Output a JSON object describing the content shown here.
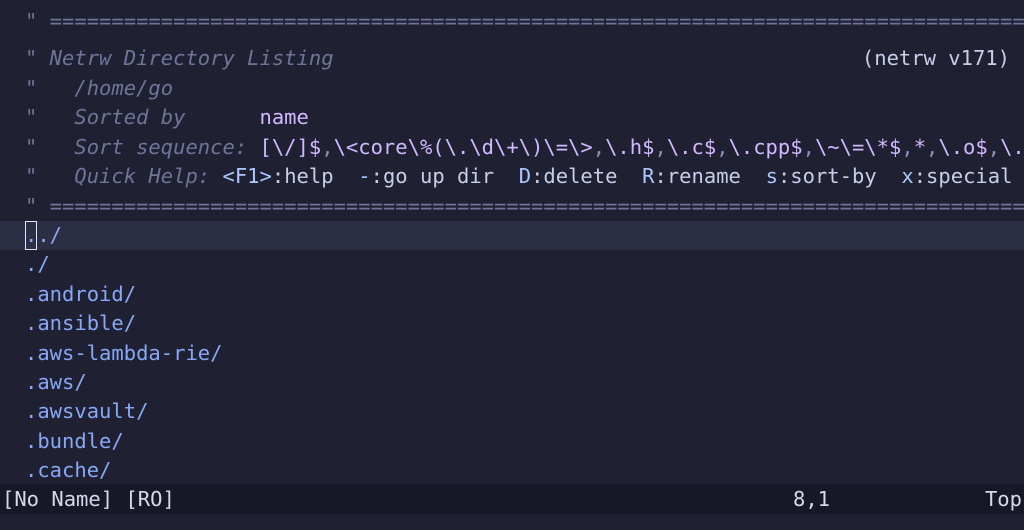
{
  "banner": {
    "rule_line": "\" ============================================================================================================",
    "title_prefix": "\" Netrw Directory Listing",
    "version": "(netrw v171)",
    "path_prefix": "\"   ",
    "path": "/home/go",
    "sorted_by_label": "\"   Sorted by      ",
    "sorted_by_value": "name",
    "sort_seq_label": "\"   Sort sequence: ",
    "sort_seq_value": "[\\/]$,\\<core\\%(\\.\\d\\+\\)\\=\\>,\\.h$,\\.c$,\\.cpp$,\\~\\=\\*$,*,\\.o$,\\.obj$,\\.info$,\\.swp$,\\.bak$,\\~$",
    "quick_help_label": "\"   Quick Help: ",
    "quick_help": [
      {
        "key": "<F1>",
        "desc": ":help  "
      },
      {
        "key": "-",
        "desc": ":go up dir  "
      },
      {
        "key": "D",
        "desc": ":delete  "
      },
      {
        "key": "R",
        "desc": ":rename  "
      },
      {
        "key": "s",
        "desc": ":sort-by  "
      },
      {
        "key": "x",
        "desc": ":special"
      }
    ]
  },
  "entries": [
    {
      "name": "../",
      "cursor": true
    },
    {
      "name": "./"
    },
    {
      "name": ".android/"
    },
    {
      "name": ".ansible/"
    },
    {
      "name": ".aws-lambda-rie/"
    },
    {
      "name": ".aws/"
    },
    {
      "name": ".awsvault/"
    },
    {
      "name": ".bundle/"
    },
    {
      "name": ".cache/"
    }
  ],
  "statusline": {
    "buffer": "[No Name] [RO]",
    "position": "8,1",
    "scroll": "Top"
  },
  "colors": {
    "background": "#1f2133",
    "cursorline": "#2b2e44",
    "comment": "#6f7498",
    "directory": "#88a8f5",
    "value": "#d2b8ff",
    "statusline_bg": "#171827"
  }
}
